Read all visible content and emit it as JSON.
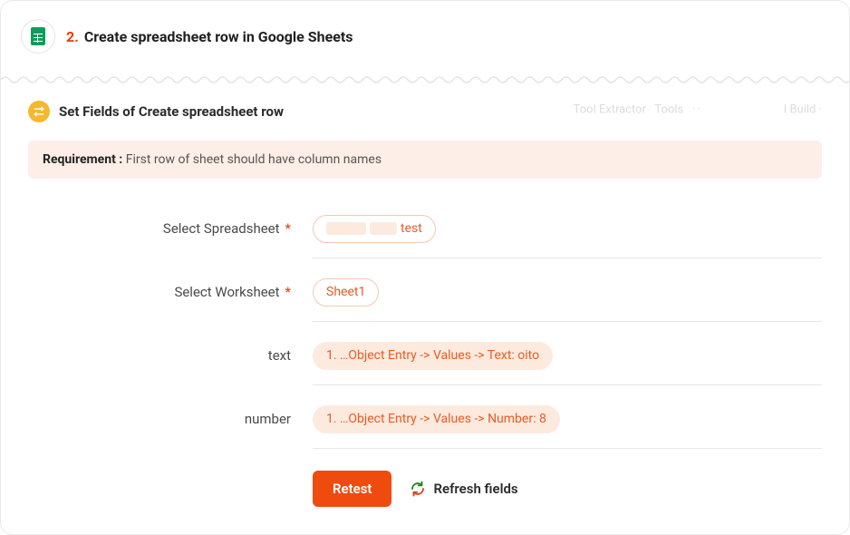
{
  "header": {
    "step_number": "2.",
    "title": "Create spreadsheet row in Google Sheets",
    "app_icon": "google-sheets-icon"
  },
  "subheader": {
    "icon": "swap-icon",
    "title": "Set Fields of Create spreadsheet row",
    "ghost_left": "Tool Extractor",
    "ghost_mid": "Tools",
    "ghost_sep": "··",
    "ghost_right": "I Build ·"
  },
  "requirement": {
    "label": "Requirement :",
    "text": "First row of sheet should have column names"
  },
  "fields": {
    "spreadsheet": {
      "label": "Select Spreadsheet",
      "required": true,
      "value_suffix": "test"
    },
    "worksheet": {
      "label": "Select Worksheet",
      "required": true,
      "value": "Sheet1"
    },
    "text": {
      "label": "text",
      "required": false,
      "value": "1. …Object Entry -> Values -> Text: oito"
    },
    "number": {
      "label": "number",
      "required": false,
      "value": "1. …Object Entry -> Values -> Number: 8"
    }
  },
  "actions": {
    "retest": "Retest",
    "refresh": "Refresh fields"
  },
  "colors": {
    "accent": "#f04b0f",
    "pill_border": "#f3c8b0",
    "pill_solid_bg": "#fdeadf",
    "banner_bg": "#fdefe7"
  }
}
